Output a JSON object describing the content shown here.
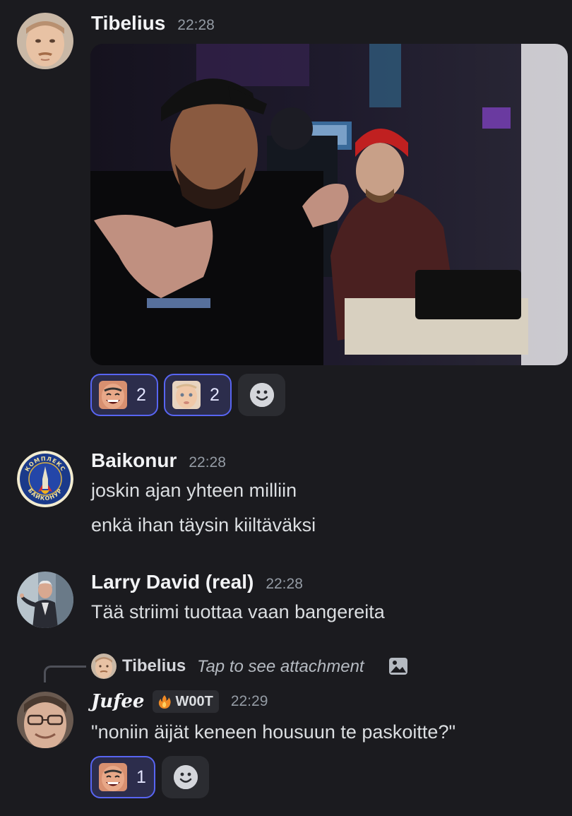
{
  "messages": [
    {
      "username": "Tibelius",
      "time": "22:28",
      "reactions": [
        {
          "emote": "laughing-face-emote",
          "count": "2"
        },
        {
          "emote": "baby-face-emote",
          "count": "2"
        }
      ]
    },
    {
      "username": "Baikonur",
      "time": "22:28",
      "lines": [
        "joskin ajan yhteen milliin",
        "enkä ihan täysin kiiltäväksi"
      ],
      "avatar_seal": [
        "КОМПЛЕКС",
        "БАЙКОНУР"
      ]
    },
    {
      "username": "Larry David (real)",
      "time": "22:28",
      "lines": [
        "Tää striimi tuottaa vaan bangereita"
      ]
    },
    {
      "reply_to": {
        "username": "Tibelius",
        "text": "Tap to see attachment"
      },
      "username": "Jufee",
      "tag": "W00T",
      "time": "22:29",
      "lines": [
        "\"noniin äijät keneen housuun te paskoitte?\""
      ],
      "reactions": [
        {
          "emote": "laughing-face-emote",
          "count": "1"
        }
      ]
    }
  ],
  "icons": {
    "add_reaction": "smile-face-icon",
    "reply_attachment": "image-icon",
    "tag": "fire-icon"
  },
  "colors": {
    "background": "#1b1b1f",
    "reaction_border": "#5865f2",
    "reaction_bg": "#2c2d4c",
    "timestamp": "#949ba4"
  }
}
